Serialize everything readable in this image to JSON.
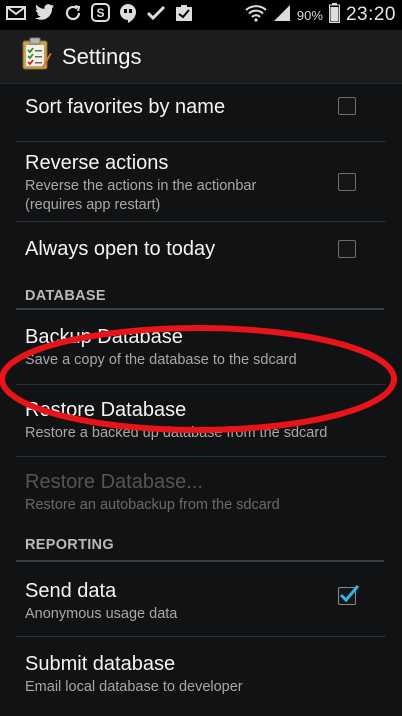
{
  "status_bar": {
    "battery_percent": "90%",
    "time": "23:20",
    "icons": [
      "mail-icon",
      "twitter-icon",
      "sync-icon",
      "skype-icon",
      "hangouts-icon",
      "check-icon",
      "tasks-icon",
      "wifi-icon",
      "signal-icon",
      "battery-icon"
    ]
  },
  "action_bar": {
    "title": "Settings",
    "icon": "clipboard-settings-icon"
  },
  "preferences": {
    "sort_favorites": {
      "title": "Sort favorites by name",
      "checked": false
    },
    "reverse_actions": {
      "title": "Reverse actions",
      "summary_line1": "Reverse the actions in the actionbar",
      "summary_line2": "(requires app restart)",
      "checked": false
    },
    "always_open_today": {
      "title": "Always open to today",
      "checked": false
    },
    "database_header": "DATABASE",
    "backup": {
      "title": "Backup Database",
      "summary": "Save a copy of the database to the sdcard"
    },
    "restore": {
      "title": "Restore Database",
      "summary": "Restore a backed up database from the sdcard"
    },
    "restore_auto": {
      "title": "Restore Database...",
      "summary": "Restore an autobackup from the sdcard",
      "enabled": false
    },
    "reporting_header": "REPORTING",
    "send_data": {
      "title": "Send data",
      "summary": "Anonymous usage data",
      "checked": true
    },
    "submit_db": {
      "title": "Submit database",
      "summary": "Email local database to developer"
    }
  },
  "colors": {
    "accent_check": "#33b5e5",
    "annotation_red": "#e8141a"
  }
}
